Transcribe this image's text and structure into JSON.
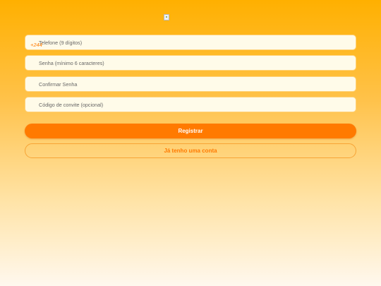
{
  "form": {
    "phone_prefix": "+244",
    "phone_placeholder": "Telefone (9 dígitos)",
    "password_placeholder": "Senha (mínimo 6 caracteres)",
    "confirm_placeholder": "Confirmar Senha",
    "invite_placeholder": "Código de convite (opcional)"
  },
  "actions": {
    "register_label": "Registrar",
    "login_label": "Já tenho uma conta"
  },
  "colors": {
    "accent": "#ff7a00",
    "field_bg": "#fffbe9",
    "field_border": "#ffd27a"
  }
}
